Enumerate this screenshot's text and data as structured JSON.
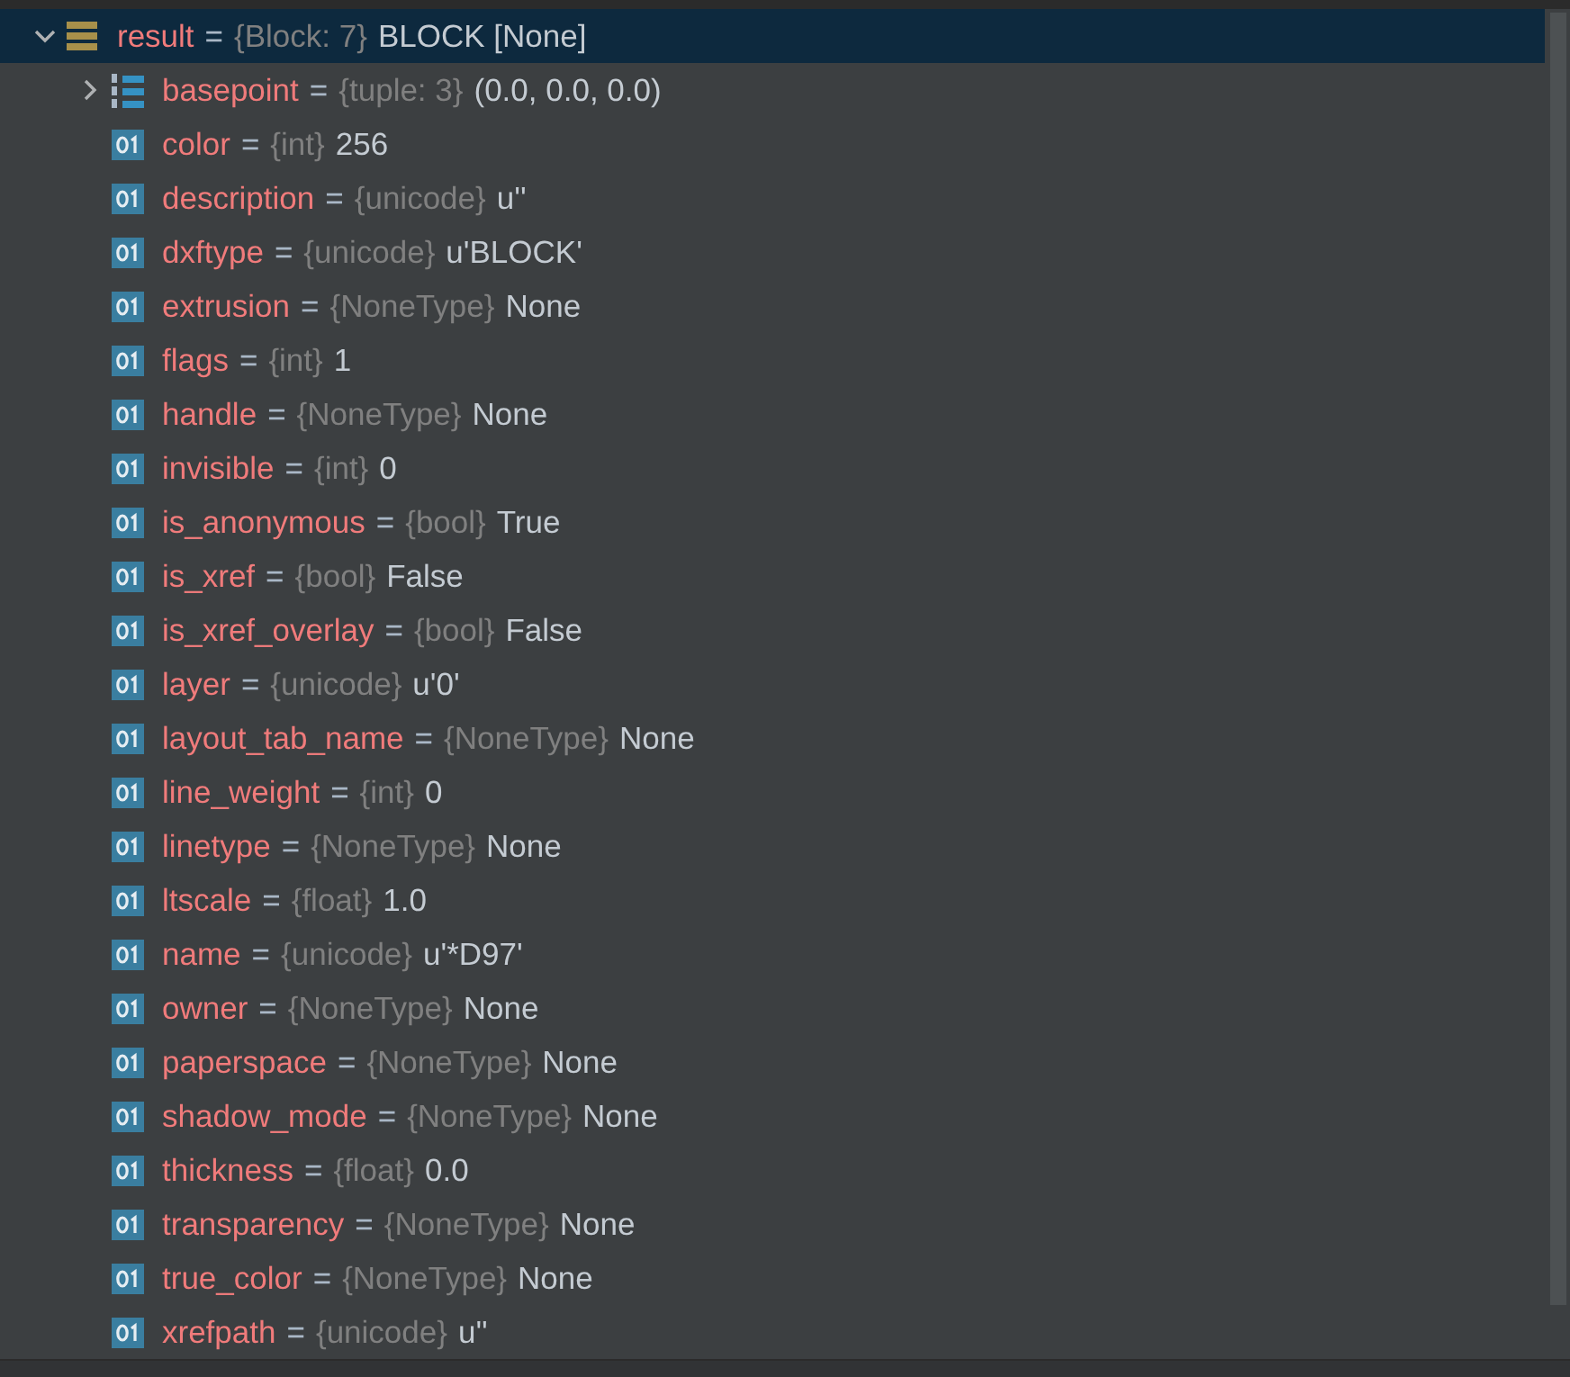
{
  "variables": [
    {
      "kind": "object",
      "name": "result",
      "equals": "=",
      "type": "{Block: 7}",
      "value": "BLOCK [None]",
      "expanded": true,
      "selected": true,
      "children": [
        {
          "kind": "tuple",
          "name": "basepoint",
          "equals": "=",
          "type": "{tuple: 3}",
          "value": "(0.0, 0.0, 0.0)",
          "expanded": false,
          "selected": false
        },
        {
          "kind": "primitive",
          "name": "color",
          "equals": "=",
          "type": "{int}",
          "value": "256",
          "selected": false
        },
        {
          "kind": "primitive",
          "name": "description",
          "equals": "=",
          "type": "{unicode}",
          "value": "u''",
          "selected": false
        },
        {
          "kind": "primitive",
          "name": "dxftype",
          "equals": "=",
          "type": "{unicode}",
          "value": "u'BLOCK'",
          "selected": false
        },
        {
          "kind": "primitive",
          "name": "extrusion",
          "equals": "=",
          "type": "{NoneType}",
          "value": "None",
          "selected": false
        },
        {
          "kind": "primitive",
          "name": "flags",
          "equals": "=",
          "type": "{int}",
          "value": "1",
          "selected": false
        },
        {
          "kind": "primitive",
          "name": "handle",
          "equals": "=",
          "type": "{NoneType}",
          "value": "None",
          "selected": false
        },
        {
          "kind": "primitive",
          "name": "invisible",
          "equals": "=",
          "type": "{int}",
          "value": "0",
          "selected": false
        },
        {
          "kind": "primitive",
          "name": "is_anonymous",
          "equals": "=",
          "type": "{bool}",
          "value": "True",
          "selected": false
        },
        {
          "kind": "primitive",
          "name": "is_xref",
          "equals": "=",
          "type": "{bool}",
          "value": "False",
          "selected": false
        },
        {
          "kind": "primitive",
          "name": "is_xref_overlay",
          "equals": "=",
          "type": "{bool}",
          "value": "False",
          "selected": false
        },
        {
          "kind": "primitive",
          "name": "layer",
          "equals": "=",
          "type": "{unicode}",
          "value": "u'0'",
          "selected": false
        },
        {
          "kind": "primitive",
          "name": "layout_tab_name",
          "equals": "=",
          "type": "{NoneType}",
          "value": "None",
          "selected": false
        },
        {
          "kind": "primitive",
          "name": "line_weight",
          "equals": "=",
          "type": "{int}",
          "value": "0",
          "selected": false
        },
        {
          "kind": "primitive",
          "name": "linetype",
          "equals": "=",
          "type": "{NoneType}",
          "value": "None",
          "selected": false
        },
        {
          "kind": "primitive",
          "name": "ltscale",
          "equals": "=",
          "type": "{float}",
          "value": "1.0",
          "selected": false
        },
        {
          "kind": "primitive",
          "name": "name",
          "equals": "=",
          "type": "{unicode}",
          "value": "u'*D97'",
          "selected": false
        },
        {
          "kind": "primitive",
          "name": "owner",
          "equals": "=",
          "type": "{NoneType}",
          "value": "None",
          "selected": false
        },
        {
          "kind": "primitive",
          "name": "paperspace",
          "equals": "=",
          "type": "{NoneType}",
          "value": "None",
          "selected": false
        },
        {
          "kind": "primitive",
          "name": "shadow_mode",
          "equals": "=",
          "type": "{NoneType}",
          "value": "None",
          "selected": false
        },
        {
          "kind": "primitive",
          "name": "thickness",
          "equals": "=",
          "type": "{float}",
          "value": "0.0",
          "selected": false
        },
        {
          "kind": "primitive",
          "name": "transparency",
          "equals": "=",
          "type": "{NoneType}",
          "value": "None",
          "selected": false
        },
        {
          "kind": "primitive",
          "name": "true_color",
          "equals": "=",
          "type": "{NoneType}",
          "value": "None",
          "selected": false
        },
        {
          "kind": "primitive",
          "name": "xrefpath",
          "equals": "=",
          "type": "{unicode}",
          "value": "u''",
          "selected": false
        }
      ]
    }
  ]
}
